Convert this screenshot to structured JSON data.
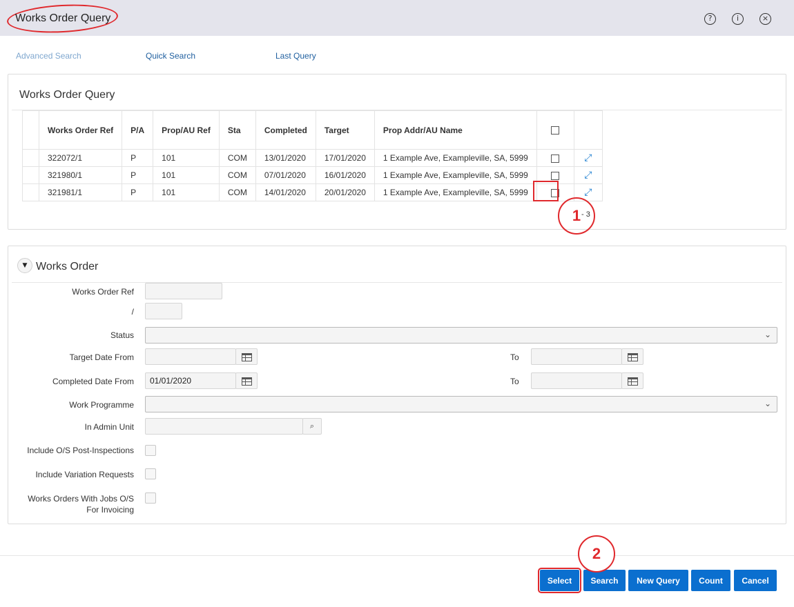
{
  "window": {
    "title": "Works Order Query",
    "icons": [
      "help-icon",
      "info-icon",
      "close-icon"
    ]
  },
  "nav": {
    "advanced_search": "Advanced Search",
    "quick_search": "Quick Search",
    "last_query": "Last Query"
  },
  "results": {
    "title": "Works Order Query",
    "columns": [
      "Works Order Ref",
      "P/A",
      "Prop/AU Ref",
      "Sta",
      "Completed",
      "Target",
      "Prop Addr/AU Name"
    ],
    "rows": [
      [
        "322072/1",
        "P",
        "101",
        "COM",
        "13/01/2020",
        "17/01/2020",
        "1 Example Ave, Exampleville, SA, 5999"
      ],
      [
        "321980/1",
        "P",
        "101",
        "COM",
        "07/01/2020",
        "16/01/2020",
        "1 Example Ave, Exampleville, SA, 5999"
      ],
      [
        "321981/1",
        "P",
        "101",
        "COM",
        "14/01/2020",
        "20/01/2020",
        "1 Example Ave, Exampleville, SA, 5999"
      ]
    ],
    "count_text": "- 3"
  },
  "annotations": {
    "step1": "1",
    "step2": "2",
    "color": "#e0282c"
  },
  "form": {
    "title": "Works Order",
    "works_order_ref_label": "Works Order Ref",
    "works_order_ref_value": "",
    "slash_label": "/",
    "suffix_value": "",
    "status_label": "Status",
    "status_value": "",
    "target_date_from_label": "Target Date From",
    "target_date_from_value": "",
    "target_to_label": "To",
    "target_to_value": "",
    "completed_date_from_label": "Completed Date From",
    "completed_date_from_value": "01/01/2020",
    "completed_to_label": "To",
    "completed_to_value": "",
    "work_programme_label": "Work Programme",
    "work_programme_value": "",
    "admin_unit_label": "In Admin Unit",
    "admin_unit_value": "",
    "include_os_label": "Include O/S Post-Inspections",
    "include_variation_label": "Include Variation Requests",
    "jobs_os_label_1": "Works Orders With Jobs O/S",
    "jobs_os_label_2": "For Invoicing"
  },
  "buttons": {
    "select": "Select",
    "search": "Search",
    "new_query": "New Query",
    "count": "Count",
    "cancel": "Cancel"
  },
  "colors": {
    "accent": "#0b6fcf",
    "titlebar": "#e4e4ec",
    "link": "#1f5f9f"
  }
}
